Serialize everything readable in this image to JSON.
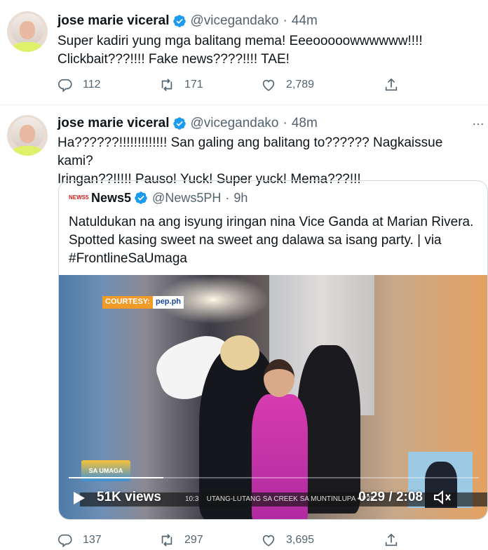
{
  "tweets": [
    {
      "author": {
        "name": "jose marie viceral",
        "handle": "@vicegandako",
        "verified": true
      },
      "time": "44m",
      "text": [
        "Super kadiri yung mga balitang mema! Eeeooooowwwwww!!!!",
        "Clickbait???!!!! Fake news????!!!! TAE!"
      ],
      "stats": {
        "replies": "112",
        "retweets": "171",
        "likes": "2,789"
      }
    },
    {
      "author": {
        "name": "jose marie viceral",
        "handle": "@vicegandako",
        "verified": true
      },
      "time": "48m",
      "text": [
        "Ha??????!!!!!!!!!!!!! San galing ang balitang to??????  Nagkaissue kami?",
        "Iringan??!!!!! Pauso! Yuck! Super yuck! Mema???!!!"
      ],
      "quote": {
        "author": {
          "name": "News5",
          "handle": "@News5PH",
          "verified": true,
          "logo": "NEWS5"
        },
        "time": "9h",
        "text": [
          "Natuldukan na ang isyung iringan nina Vice Ganda at Marian Rivera.",
          "Spotted kasing sweet na sweet ang dalawa sa isang party. | via",
          "#FrontlineSaUmaga"
        ],
        "video": {
          "views": "51K views",
          "timecode": "0:29 / 2:08",
          "progress": 0.23,
          "courtesy_label": "COURTESY:",
          "courtesy_source": "pep.ph",
          "ticker_time": "10:3",
          "ticker_text": "UTANG-LUTANG SA CREEK SA MUNTINLUPA  •  P35",
          "show_logo": "SA UMAGA"
        }
      },
      "stats": {
        "replies": "137",
        "retweets": "297",
        "likes": "3,695"
      }
    }
  ],
  "colors": {
    "verified": "#1d9bf0",
    "muted": "#536471",
    "text": "#0f1419",
    "border": "#cfd9de"
  },
  "icons": {
    "more": "…",
    "dot": "·"
  }
}
